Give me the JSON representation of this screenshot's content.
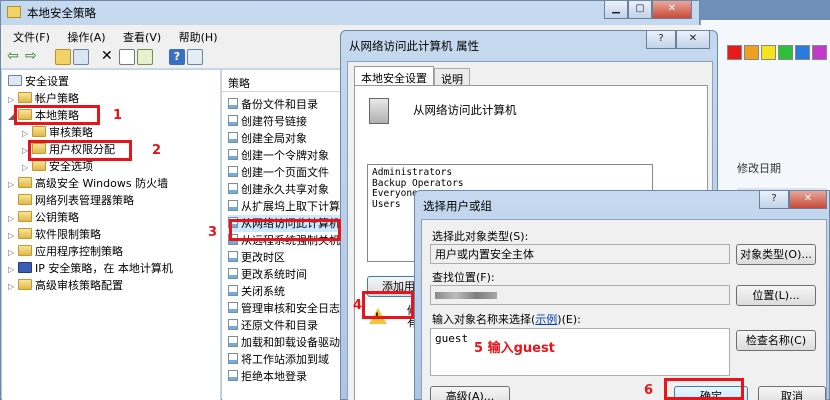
{
  "main_window": {
    "title": "本地安全策略",
    "menu": [
      "文件(F)",
      "操作(A)",
      "查看(V)",
      "帮助(H)"
    ],
    "tree": [
      {
        "label": "安全设置",
        "level": 0
      },
      {
        "label": "帐户策略",
        "level": 1
      },
      {
        "label": "本地策略",
        "level": 1
      },
      {
        "label": "审核策略",
        "level": 2
      },
      {
        "label": "用户权限分配",
        "level": 2
      },
      {
        "label": "安全选项",
        "level": 2
      },
      {
        "label": "高级安全 Windows 防火墙",
        "level": 1
      },
      {
        "label": "网络列表管理器策略",
        "level": 1
      },
      {
        "label": "公钥策略",
        "level": 1
      },
      {
        "label": "软件限制策略",
        "level": 1
      },
      {
        "label": "应用程序控制策略",
        "level": 1
      },
      {
        "label": "IP 安全策略，在 本地计算机",
        "level": 1
      },
      {
        "label": "高级审核策略配置",
        "level": 1
      }
    ],
    "column_header": "策略",
    "policies": [
      "备份文件和目录",
      "创建符号链接",
      "创建全局对象",
      "创建一个令牌对象",
      "创建一个页面文件",
      "创建永久共享对象",
      "从扩展坞上取下计算机",
      "从网络访问此计算机",
      "从远程系统强制关机",
      "更改时区",
      "更改系统时间",
      "关闭系统",
      "管理审核和安全日志",
      "还原文件和目录",
      "加载和卸载设备驱动程序",
      "将工作站添加到域",
      "拒绝本地登录"
    ]
  },
  "background_window": {
    "column_header": "修改日期"
  },
  "properties_dialog": {
    "title": "从网络访问此计算机 属性",
    "tabs": [
      "本地安全设置",
      "说明"
    ],
    "heading": "从网络访问此计算机",
    "members": [
      "Administrators",
      "Backup Operators",
      "Everyone",
      "Users"
    ],
    "add_button": "添加用",
    "warning_text_1": "修",
    "warning_text_2": "有"
  },
  "select_dialog": {
    "title": "选择用户或组",
    "help_glyph": "?",
    "object_type_label": "选择此对象类型(S):",
    "object_type_value": "用户或内置安全主体",
    "object_type_button": "对象类型(O)...",
    "location_label": "查找位置(F):",
    "location_button": "位置(L)...",
    "name_label_prefix": "输入对象名称来选择(",
    "name_label_link": "示例",
    "name_label_suffix": ")(E):",
    "name_value": "guest",
    "check_names_button": "检查名称(C)",
    "advanced_button": "高级(A)...",
    "ok_button": "确定",
    "cancel_button": "取消"
  },
  "annotations": [
    "1",
    "2",
    "3",
    "4",
    "5 输入guest",
    "6"
  ],
  "colors": {
    "annotation_red": "#e8141b",
    "frame_blue": "#c5d9ef",
    "selection_blue": "#cde8ff"
  }
}
